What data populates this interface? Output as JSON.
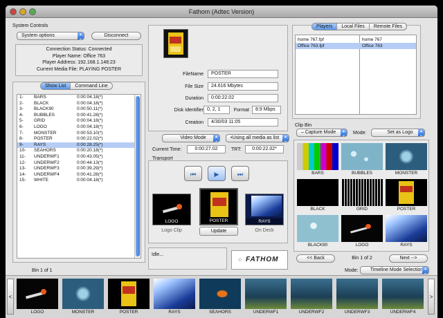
{
  "window": {
    "title": "Fathom (Adtec Version)"
  },
  "system": {
    "section_label": "System Controls",
    "options_label": "System options",
    "disconnect_label": "Disconnect",
    "status_lines": [
      "Connection Status: Connected",
      "Player Name: Office 763",
      "Player Address: 192.168.1.148:23",
      "Current Media File: PLAYING POSTER"
    ]
  },
  "showlist": {
    "tabs": [
      "Show List",
      "Command Line"
    ],
    "items": [
      {
        "n": "1-",
        "name": "BARS",
        "dur": "0:00:04.18(*)"
      },
      {
        "n": "2-",
        "name": "BLACK",
        "dur": "0:00:04.18(*)"
      },
      {
        "n": "3-",
        "name": "BLACK90",
        "dur": "0:00:50.11(*)"
      },
      {
        "n": "4-",
        "name": "BUBBLES",
        "dur": "0:00:41.28(*)"
      },
      {
        "n": "5-",
        "name": "GRID",
        "dur": "0:00:04.18(*)"
      },
      {
        "n": "6-",
        "name": "LOGO",
        "dur": "0:00:04.18(*)"
      },
      {
        "n": "7-",
        "name": "MONSTER",
        "dur": "0:00:53.10(*)"
      },
      {
        "n": "8-",
        "name": "POSTER",
        "dur": "0:00:22.02(*)"
      },
      {
        "n": "9-",
        "name": "RAYS",
        "dur": "0:00:28.25(*)"
      },
      {
        "n": "10-",
        "name": "SEAHORS",
        "dur": "0:00:20.18(*)"
      },
      {
        "n": "11-",
        "name": "UNDERWF1",
        "dur": "0:00:43.05(*)"
      },
      {
        "n": "12-",
        "name": "UNDERWF2",
        "dur": "0:00:44.13(*)"
      },
      {
        "n": "13-",
        "name": "UNDERWF3",
        "dur": "0:00:39.29(*)"
      },
      {
        "n": "14-",
        "name": "UNDERWF4",
        "dur": "0:00:41.28(*)"
      },
      {
        "n": "15-",
        "name": "WHITE",
        "dur": "0:00:04.18(*)"
      }
    ],
    "selected_index": 8
  },
  "fileinfo": {
    "filename_label": "FileName",
    "filename": "POSTER",
    "filesize_label": "File Size",
    "filesize": "24.616 Mbytes",
    "duration_label": "Duration",
    "duration": "0:00:22.02",
    "disk_label": "Disk Identifier",
    "disk": "0, 2, 1",
    "format_label": "Format",
    "format": "8:9 Mbps",
    "creation_label": "Creation",
    "creation": "4/30/03 11:05"
  },
  "modes": {
    "video_mode": "Video Mode",
    "using_list": "•Using all media as list"
  },
  "times": {
    "current_label": "Current Time:",
    "current": "0:00:27.02",
    "trt_label": "TRT:",
    "trt": "0:00:22.02*"
  },
  "transport": {
    "label": "Transport",
    "prev_icon": "skip-back-icon",
    "play_icon": "play-icon",
    "next_icon": "skip-forward-icon",
    "logo_clip_caption": "LOGO",
    "logo_clip_label": "Logo Clip",
    "current_caption": "POSTER",
    "update_label": "Update",
    "ondeck_caption": "RAYS",
    "ondeck_label": "On Deck"
  },
  "status": {
    "text": "Idle...",
    "brand": "FATHOM"
  },
  "players": {
    "tabs": [
      "Players",
      "Local Files",
      "Remote Files"
    ],
    "files": [
      "home 767.fpf",
      "Office 763.fpf"
    ],
    "names": [
      "home 767",
      "Office 763"
    ],
    "selected_index": 1
  },
  "clipbin": {
    "label": "Clip Bin",
    "capture_mode": "– Capture Mode",
    "mode_label": "Mode:",
    "mode_value": "Set as Logo",
    "tiles": [
      "BARS",
      "BUBBLES",
      "MONSTER",
      "BLACK",
      "GRID",
      "POSTER",
      "BLACK90",
      "LOGO",
      "RAYS"
    ],
    "back_label": "<< Back",
    "page_label": "Bin 1 of 2",
    "next_label": "Next -->"
  },
  "bottom": {
    "bin_label": "Bin 1 of 1",
    "mode_label": "Mode:",
    "mode_value": "Timeline Mode Selection",
    "left_arrow": "<",
    "right_arrow": ">",
    "strip": [
      "LOGO",
      "MONSTER",
      "POSTER",
      "RAYS",
      "SEAHORS",
      "UNDERWF1",
      "UNDERWF2",
      "UNDERWF3",
      "UNDERWF4"
    ]
  },
  "colors": {
    "selection": "#b5cdf5",
    "accent": "#3f7ad8"
  }
}
